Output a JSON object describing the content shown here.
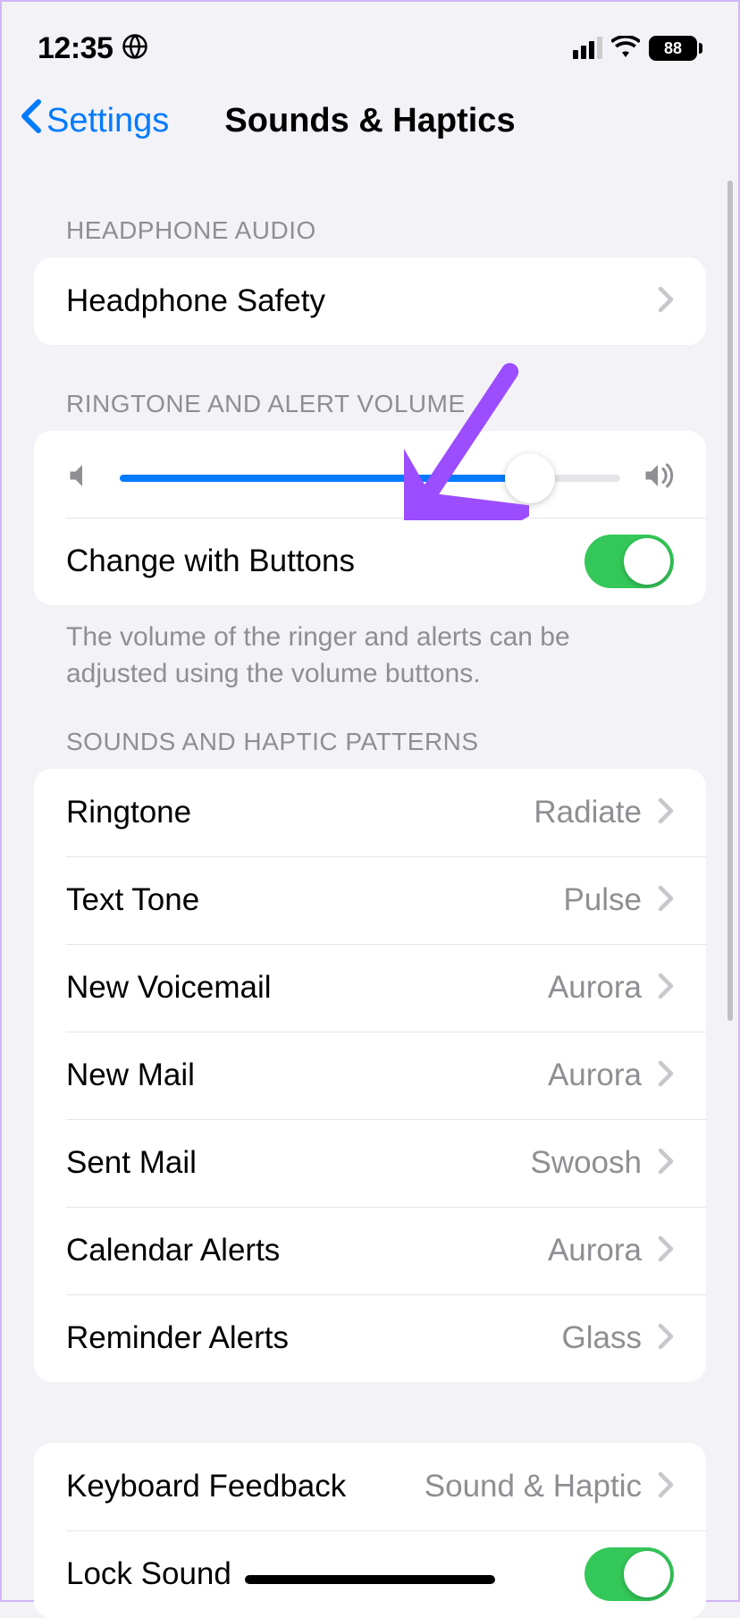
{
  "status": {
    "time": "12:35",
    "battery_percent": "88"
  },
  "nav": {
    "back_label": "Settings",
    "title": "Sounds & Haptics"
  },
  "section_headphone": {
    "header": "HEADPHONE AUDIO",
    "rows": {
      "headphone_safety": "Headphone Safety"
    }
  },
  "section_ringtone": {
    "header": "RINGTONE AND ALERT VOLUME",
    "change_with_buttons_label": "Change with Buttons",
    "change_with_buttons_on": true,
    "footer": "The volume of the ringer and alerts can be adjusted using the volume buttons.",
    "volume_percent": 82
  },
  "section_patterns": {
    "header": "SOUNDS AND HAPTIC PATTERNS",
    "items": [
      {
        "label": "Ringtone",
        "value": "Radiate"
      },
      {
        "label": "Text Tone",
        "value": "Pulse"
      },
      {
        "label": "New Voicemail",
        "value": "Aurora"
      },
      {
        "label": "New Mail",
        "value": "Aurora"
      },
      {
        "label": "Sent Mail",
        "value": "Swoosh"
      },
      {
        "label": "Calendar Alerts",
        "value": "Aurora"
      },
      {
        "label": "Reminder Alerts",
        "value": "Glass"
      }
    ]
  },
  "section_other": {
    "keyboard_feedback_label": "Keyboard Feedback",
    "keyboard_feedback_value": "Sound & Haptic",
    "lock_sound_label": "Lock Sound",
    "lock_sound_on": true
  }
}
